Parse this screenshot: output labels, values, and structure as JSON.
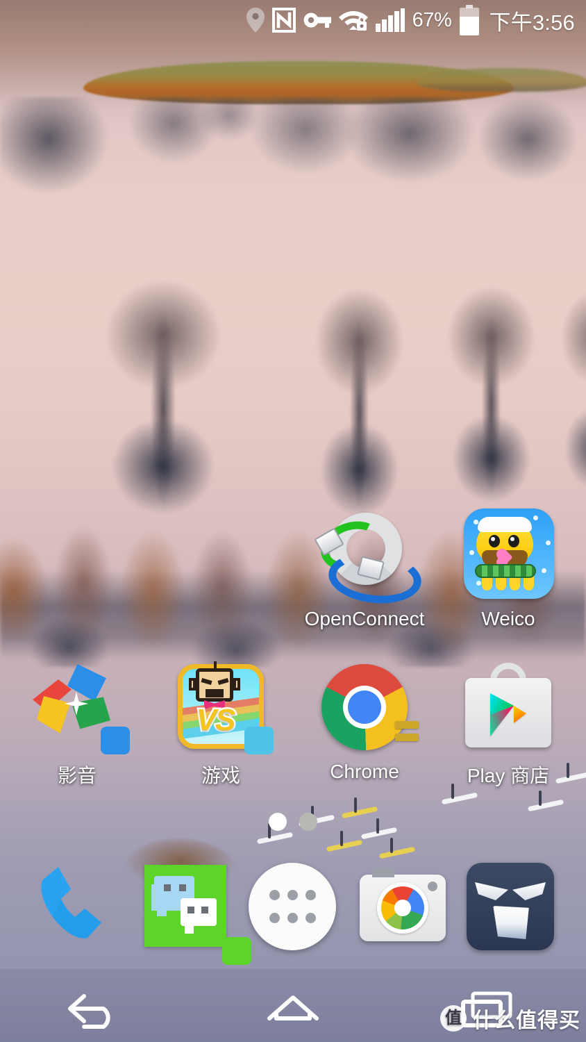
{
  "status_bar": {
    "icons": [
      {
        "name": "location-icon",
        "glyph": "location"
      },
      {
        "name": "nfc-icon",
        "glyph": "nfc"
      },
      {
        "name": "vpn-key-icon",
        "glyph": "key"
      },
      {
        "name": "wifi-secure-icon",
        "glyph": "wifi-lock"
      },
      {
        "name": "cellular-signal-icon",
        "glyph": "signal"
      }
    ],
    "battery_percent": "67%",
    "battery_level": 67,
    "clock": "下午3:56"
  },
  "home": {
    "row1": [
      {
        "name": "openconnect",
        "label": "OpenConnect",
        "icon": "openconnect-icon"
      },
      {
        "name": "weico",
        "label": "Weico",
        "icon": "weico-icon"
      }
    ],
    "row2": [
      {
        "name": "folder-media",
        "label": "影音",
        "icon": "photos-pinwheel-icon",
        "is_folder": true,
        "chip_color": "#2b8fe8"
      },
      {
        "name": "folder-games",
        "label": "游戏",
        "icon": "vs-game-icon",
        "is_folder": true,
        "chip_color": "#4fc3e8"
      },
      {
        "name": "chrome",
        "label": "Chrome",
        "icon": "chrome-icon"
      },
      {
        "name": "play-store",
        "label": "Play 商店",
        "icon": "play-store-icon"
      }
    ]
  },
  "page_indicator": {
    "count": 2,
    "active_index": 0,
    "active_color": "#ffffff",
    "inactive_color": "#b9b9b4"
  },
  "dock": [
    {
      "name": "phone",
      "icon": "phone-icon"
    },
    {
      "name": "wechat",
      "icon": "wechat-icon",
      "chip_color": "#5dd429"
    },
    {
      "name": "app-drawer",
      "icon": "app-drawer-icon"
    },
    {
      "name": "camera",
      "icon": "google-camera-icon"
    },
    {
      "name": "falcon-pro",
      "icon": "falcon-icon"
    }
  ],
  "navbar": [
    {
      "name": "back-button",
      "icon": "back-arrow-icon"
    },
    {
      "name": "home-button",
      "icon": "home-icon"
    },
    {
      "name": "recents-button",
      "icon": "recents-icon"
    }
  ],
  "watermark": {
    "logo": "值",
    "text": "什么值得买"
  },
  "colors": {
    "accent_green": "#5dd429",
    "chrome_blue": "#4285f4",
    "weico_blue": "#2f9ff5"
  }
}
